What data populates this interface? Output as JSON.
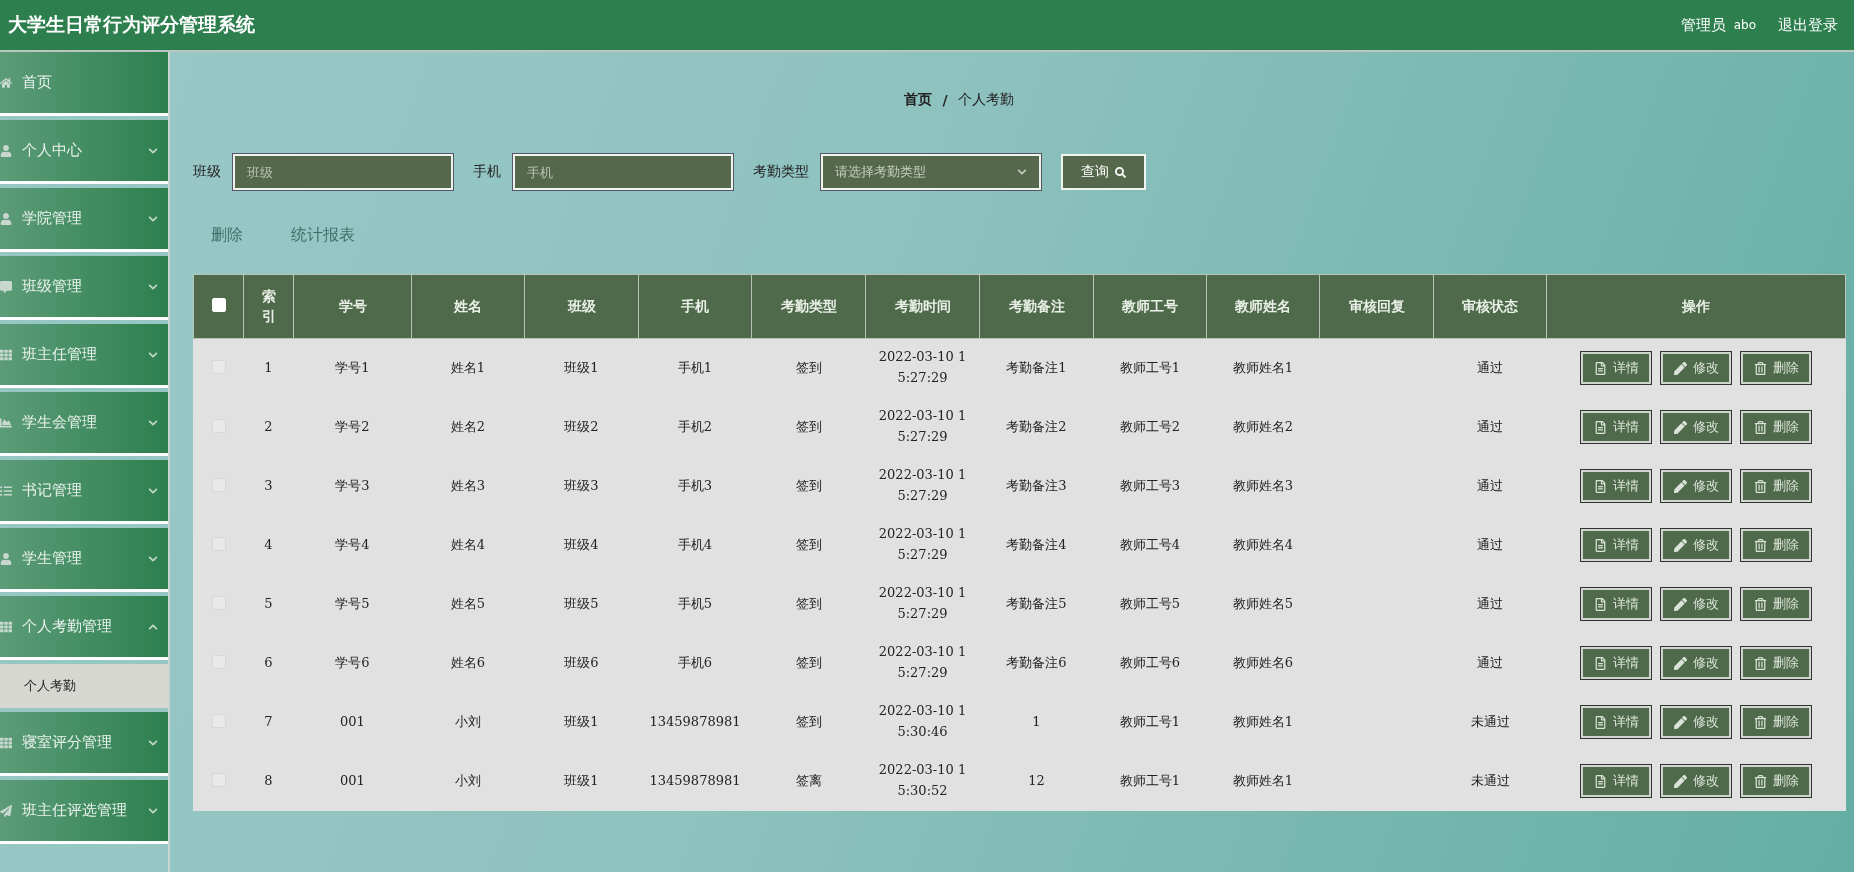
{
  "header": {
    "title": "大学生日常行为评分管理系统",
    "role": "管理员",
    "username": "abo",
    "logout": "退出登录"
  },
  "sidebar": {
    "items": [
      {
        "label": "首页",
        "expandable": false
      },
      {
        "label": "个人中心",
        "expandable": true,
        "expanded": false
      },
      {
        "label": "学院管理",
        "expandable": true,
        "expanded": false
      },
      {
        "label": "班级管理",
        "expandable": true,
        "expanded": false
      },
      {
        "label": "班主任管理",
        "expandable": true,
        "expanded": false
      },
      {
        "label": "学生会管理",
        "expandable": true,
        "expanded": false
      },
      {
        "label": "书记管理",
        "expandable": true,
        "expanded": false
      },
      {
        "label": "学生管理",
        "expandable": true,
        "expanded": false
      },
      {
        "label": "个人考勤管理",
        "expandable": true,
        "expanded": true,
        "children": [
          {
            "label": "个人考勤",
            "selected": true
          }
        ]
      },
      {
        "label": "寝室评分管理",
        "expandable": true,
        "expanded": false
      },
      {
        "label": "班主任评选管理",
        "expandable": true,
        "expanded": false
      }
    ]
  },
  "breadcrumb": [
    "首页",
    "/",
    "个人考勤"
  ],
  "search": {
    "fields": [
      {
        "label": "班级",
        "placeholder": "班级",
        "kind": "input"
      },
      {
        "label": "手机",
        "placeholder": "手机",
        "kind": "input"
      },
      {
        "label": "考勤类型",
        "placeholder": "请选择考勤类型",
        "kind": "select"
      }
    ],
    "button": "查询"
  },
  "toolbar": [
    {
      "label": "删除",
      "disabled": true
    },
    {
      "label": "统计报表",
      "disabled": true
    }
  ],
  "table": {
    "select_all": {
      "checked": false
    },
    "columns": [
      "索引",
      "学号",
      "姓名",
      "班级",
      "手机",
      "考勤类型",
      "考勤时间",
      "考勤备注",
      "教师工号",
      "教师姓名",
      "审核回复",
      "审核状态",
      "操作"
    ],
    "rows": [
      {
        "checked": false,
        "cells": [
          "1",
          "学号1",
          "姓名1",
          "班级1",
          "手机1",
          "签到",
          "2022-03-10 15:27:29",
          "考勤备注1",
          "教师工号1",
          "教师姓名1",
          "",
          "通过"
        ],
        "actions": [
          {
            "kind": "detail",
            "label": "详情"
          },
          {
            "kind": "edit",
            "label": "修改"
          },
          {
            "kind": "delete",
            "label": "删除"
          }
        ]
      },
      {
        "checked": false,
        "cells": [
          "2",
          "学号2",
          "姓名2",
          "班级2",
          "手机2",
          "签到",
          "2022-03-10 15:27:29",
          "考勤备注2",
          "教师工号2",
          "教师姓名2",
          "",
          "通过"
        ],
        "actions": [
          {
            "kind": "detail",
            "label": "详情"
          },
          {
            "kind": "edit",
            "label": "修改"
          },
          {
            "kind": "delete",
            "label": "删除"
          }
        ]
      },
      {
        "checked": false,
        "cells": [
          "3",
          "学号3",
          "姓名3",
          "班级3",
          "手机3",
          "签到",
          "2022-03-10 15:27:29",
          "考勤备注3",
          "教师工号3",
          "教师姓名3",
          "",
          "通过"
        ],
        "actions": [
          {
            "kind": "detail",
            "label": "详情"
          },
          {
            "kind": "edit",
            "label": "修改"
          },
          {
            "kind": "delete",
            "label": "删除"
          }
        ]
      },
      {
        "checked": false,
        "cells": [
          "4",
          "学号4",
          "姓名4",
          "班级4",
          "手机4",
          "签到",
          "2022-03-10 15:27:29",
          "考勤备注4",
          "教师工号4",
          "教师姓名4",
          "",
          "通过"
        ],
        "actions": [
          {
            "kind": "detail",
            "label": "详情"
          },
          {
            "kind": "edit",
            "label": "修改"
          },
          {
            "kind": "delete",
            "label": "删除"
          }
        ]
      },
      {
        "checked": false,
        "cells": [
          "5",
          "学号5",
          "姓名5",
          "班级5",
          "手机5",
          "签到",
          "2022-03-10 15:27:29",
          "考勤备注5",
          "教师工号5",
          "教师姓名5",
          "",
          "通过"
        ],
        "actions": [
          {
            "kind": "detail",
            "label": "详情"
          },
          {
            "kind": "edit",
            "label": "修改"
          },
          {
            "kind": "delete",
            "label": "删除"
          }
        ]
      },
      {
        "checked": false,
        "cells": [
          "6",
          "学号6",
          "姓名6",
          "班级6",
          "手机6",
          "签到",
          "2022-03-10 15:27:29",
          "考勤备注6",
          "教师工号6",
          "教师姓名6",
          "",
          "通过"
        ],
        "actions": [
          {
            "kind": "detail",
            "label": "详情"
          },
          {
            "kind": "edit",
            "label": "修改"
          },
          {
            "kind": "delete",
            "label": "删除"
          }
        ]
      },
      {
        "checked": false,
        "cells": [
          "7",
          "001",
          "小刘",
          "班级1",
          "13459878981",
          "签到",
          "2022-03-10 15:30:46",
          "1",
          "教师工号1",
          "教师姓名1",
          "",
          "未通过"
        ],
        "actions": [
          {
            "kind": "detail",
            "label": "详情"
          },
          {
            "kind": "edit",
            "label": "修改"
          },
          {
            "kind": "delete",
            "label": "删除"
          }
        ]
      },
      {
        "checked": false,
        "cells": [
          "8",
          "001",
          "小刘",
          "班级1",
          "13459878981",
          "签离",
          "2022-03-10 15:30:52",
          "12",
          "教师工号1",
          "教师姓名1",
          "",
          "未通过"
        ],
        "actions": [
          {
            "kind": "detail",
            "label": "详情"
          },
          {
            "kind": "edit",
            "label": "修改"
          },
          {
            "kind": "delete",
            "label": "删除"
          }
        ]
      }
    ]
  }
}
